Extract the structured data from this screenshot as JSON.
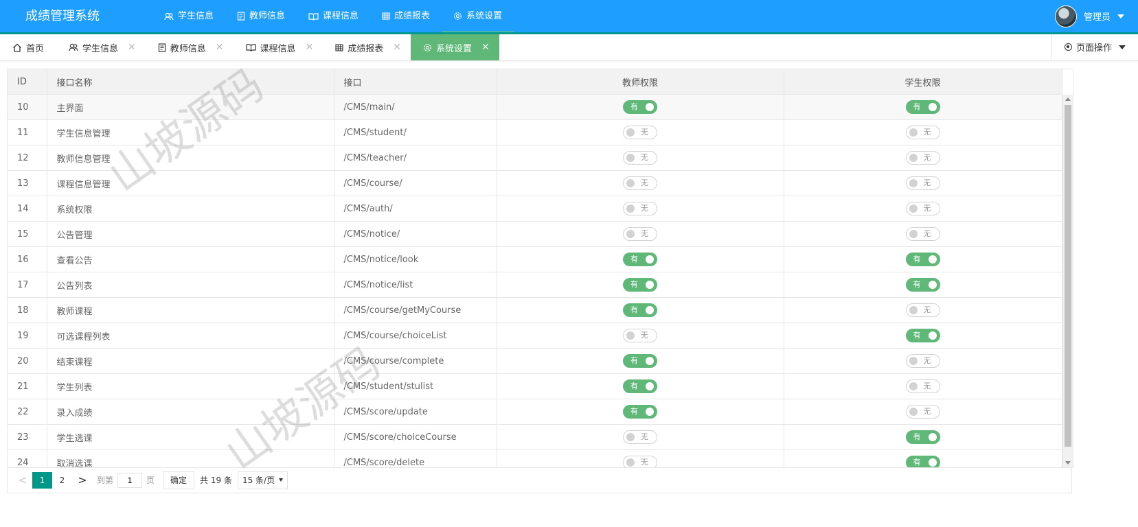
{
  "header": {
    "logo": "成绩管理系统",
    "nav": [
      {
        "icon": "users-icon",
        "label": "学生信息"
      },
      {
        "icon": "document-icon",
        "label": "教师信息"
      },
      {
        "icon": "book-icon",
        "label": "课程信息"
      },
      {
        "icon": "table-icon",
        "label": "成绩报表"
      },
      {
        "icon": "gear-icon",
        "label": "系统设置"
      }
    ],
    "active_nav": "系统设置",
    "user_name": "管理员"
  },
  "tabs": {
    "items": [
      {
        "icon": "home-icon",
        "label": "首页",
        "closable": false
      },
      {
        "icon": "users-icon",
        "label": "学生信息",
        "closable": true
      },
      {
        "icon": "document-icon",
        "label": "教师信息",
        "closable": true
      },
      {
        "icon": "book-icon",
        "label": "课程信息",
        "closable": true
      },
      {
        "icon": "table-icon",
        "label": "成绩报表",
        "closable": true
      },
      {
        "icon": "gear-icon",
        "label": "系统设置",
        "closable": true
      }
    ],
    "active": "系统设置",
    "page_op_label": "页面操作",
    "close_glyph": "✕"
  },
  "table": {
    "columns": [
      "ID",
      "接口名称",
      "接口",
      "教师权限",
      "学生权限"
    ],
    "on_label": "有",
    "off_label": "无",
    "rows": [
      {
        "id": "10",
        "name": "主界面",
        "path": "/CMS/main/",
        "teacher": true,
        "student": true
      },
      {
        "id": "11",
        "name": "学生信息管理",
        "path": "/CMS/student/",
        "teacher": false,
        "student": false
      },
      {
        "id": "12",
        "name": "教师信息管理",
        "path": "/CMS/teacher/",
        "teacher": false,
        "student": false
      },
      {
        "id": "13",
        "name": "课程信息管理",
        "path": "/CMS/course/",
        "teacher": false,
        "student": false
      },
      {
        "id": "14",
        "name": "系统权限",
        "path": "/CMS/auth/",
        "teacher": false,
        "student": false
      },
      {
        "id": "15",
        "name": "公告管理",
        "path": "/CMS/notice/",
        "teacher": false,
        "student": false
      },
      {
        "id": "16",
        "name": "查看公告",
        "path": "/CMS/notice/look",
        "teacher": true,
        "student": true
      },
      {
        "id": "17",
        "name": "公告列表",
        "path": "/CMS/notice/list",
        "teacher": true,
        "student": true
      },
      {
        "id": "18",
        "name": "教师课程",
        "path": "/CMS/course/getMyCourse",
        "teacher": true,
        "student": false
      },
      {
        "id": "19",
        "name": "可选课程列表",
        "path": "/CMS/course/choiceList",
        "teacher": false,
        "student": true
      },
      {
        "id": "20",
        "name": "结束课程",
        "path": "/CMS/course/complete",
        "teacher": true,
        "student": false
      },
      {
        "id": "21",
        "name": "学生列表",
        "path": "/CMS/student/stulist",
        "teacher": true,
        "student": false
      },
      {
        "id": "22",
        "name": "录入成绩",
        "path": "/CMS/score/update",
        "teacher": true,
        "student": false
      },
      {
        "id": "23",
        "name": "学生选课",
        "path": "/CMS/score/choiceCourse",
        "teacher": false,
        "student": true
      },
      {
        "id": "24",
        "name": "取消选课",
        "path": "/CMS/score/delete",
        "teacher": false,
        "student": true
      }
    ]
  },
  "pager": {
    "prev_glyph": "<",
    "next_glyph": ">",
    "pages": [
      "1",
      "2"
    ],
    "current": "1",
    "goto_label": "到第",
    "goto_value": "1",
    "page_unit": "页",
    "confirm_label": "确定",
    "total_label": "共 19 条",
    "page_size_label": "15 条/页"
  },
  "watermark": "山坡源码"
}
